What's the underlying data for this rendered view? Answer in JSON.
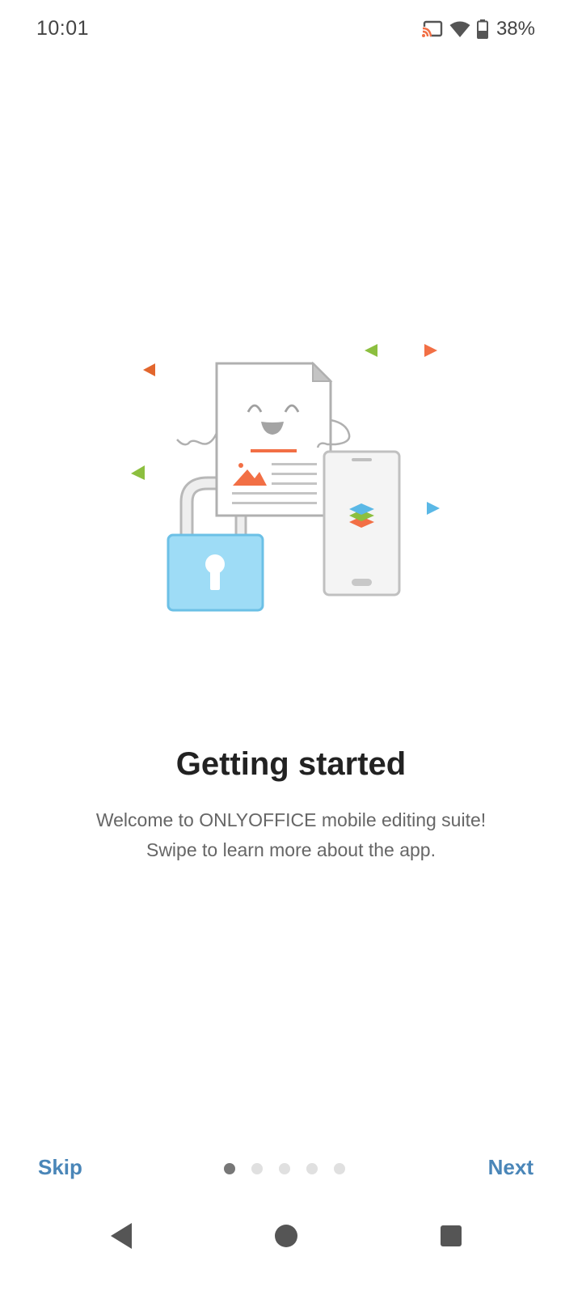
{
  "status_bar": {
    "time": "10:01",
    "battery_percent": "38%",
    "icons": [
      "cast-icon",
      "wifi-icon",
      "battery-icon"
    ]
  },
  "onboarding": {
    "title": "Getting started",
    "subtitle_line1": "Welcome to ONLYOFFICE mobile editing suite!",
    "subtitle_line2": "Swipe to learn more about the app.",
    "page_count": 5,
    "current_page": 1
  },
  "footer": {
    "skip_label": "Skip",
    "next_label": "Next"
  },
  "system_nav": {
    "icons": [
      "back-icon",
      "home-icon",
      "recents-icon"
    ]
  },
  "colors": {
    "accent": "#4a86b8",
    "lock_blue": "#9edcf6",
    "orange": "#f26f45",
    "green": "#8cbf3f",
    "sky": "#5ab8e6"
  }
}
